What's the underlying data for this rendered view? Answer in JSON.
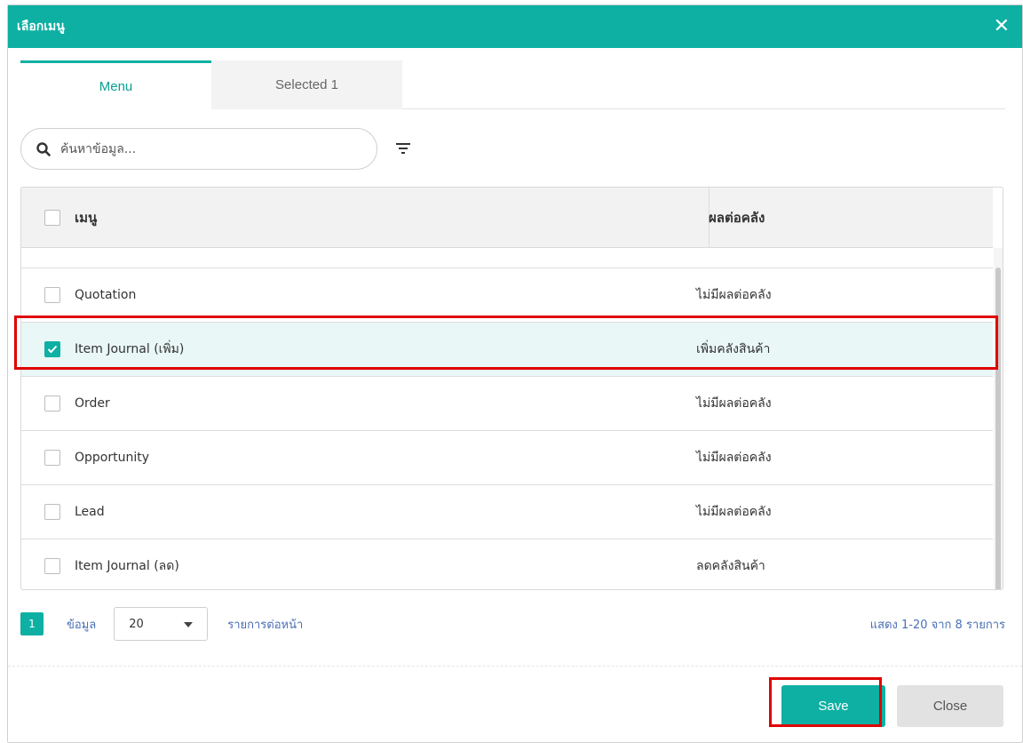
{
  "dialog": {
    "title": "เลือกเมนู",
    "close_glyph": "✕"
  },
  "tabs": [
    {
      "label": "Menu",
      "active": true
    },
    {
      "label": "Selected 1",
      "active": false
    }
  ],
  "search": {
    "placeholder": "ค้นหาข้อมูล...",
    "value": ""
  },
  "table": {
    "columns": [
      "เมนู",
      "ผลต่อคลัง"
    ],
    "rows": [
      {
        "name": "Quotation",
        "effect": "ไม่มีผลต่อคลัง",
        "checked": false
      },
      {
        "name": "Item Journal (เพิ่ม)",
        "effect": "เพิ่มคลังสินค้า",
        "checked": true
      },
      {
        "name": "Order",
        "effect": "ไม่มีผลต่อคลัง",
        "checked": false
      },
      {
        "name": "Opportunity",
        "effect": "ไม่มีผลต่อคลัง",
        "checked": false
      },
      {
        "name": "Lead",
        "effect": "ไม่มีผลต่อคลัง",
        "checked": false
      },
      {
        "name": "Item Journal (ลด)",
        "effect": "ลดคลังสินค้า",
        "checked": false
      }
    ]
  },
  "pagination": {
    "current_page": "1",
    "data_label": "ข้อมูล",
    "page_size": "20",
    "per_page_label": "รายการต่อหน้า",
    "summary": "แสดง 1-20 จาก 8 รายการ"
  },
  "footer": {
    "save_label": "Save",
    "close_label": "Close"
  },
  "colors": {
    "accent": "#0db0a3",
    "highlight": "#e00000",
    "selected_row": "#e9f7f6"
  }
}
